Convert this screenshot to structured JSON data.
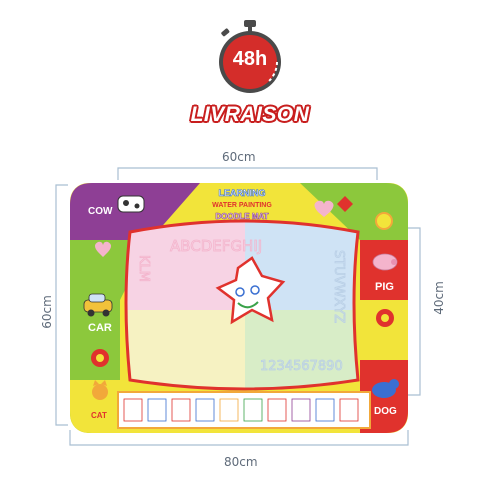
{
  "badge": {
    "hours": "48h",
    "label": "LIVRAISON",
    "color_primary": "#d42d2a",
    "color_dark": "#4a4a4a"
  },
  "dimensions": {
    "top": "60cm",
    "bottom": "80cm",
    "left": "60cm",
    "right": "40cm"
  },
  "mat": {
    "title_line1": "LEARNING",
    "title_line2": "WATER PAINTING",
    "title_line3": "DOODLE MAT",
    "alphabet_top": "ABCDEFGHIJ",
    "alphabet_right": "STUVWXYZ",
    "alphabet_left": "KLM",
    "digits": "1234567890",
    "animals": {
      "cow": "COW",
      "car": "CAR",
      "cat": "CAT",
      "pig": "PIG",
      "dog": "DOG"
    },
    "colors": {
      "frame_yellow": "#f2e43a",
      "frame_green": "#8cc83c",
      "frame_red": "#e0322d",
      "frame_purple": "#8e3f95",
      "quad_pink": "#f7d3e4",
      "quad_blue": "#cfe3f5",
      "quad_yellow": "#f6f2c2",
      "quad_green": "#d8edc7",
      "dimension_line": "#a9bfd2"
    }
  }
}
